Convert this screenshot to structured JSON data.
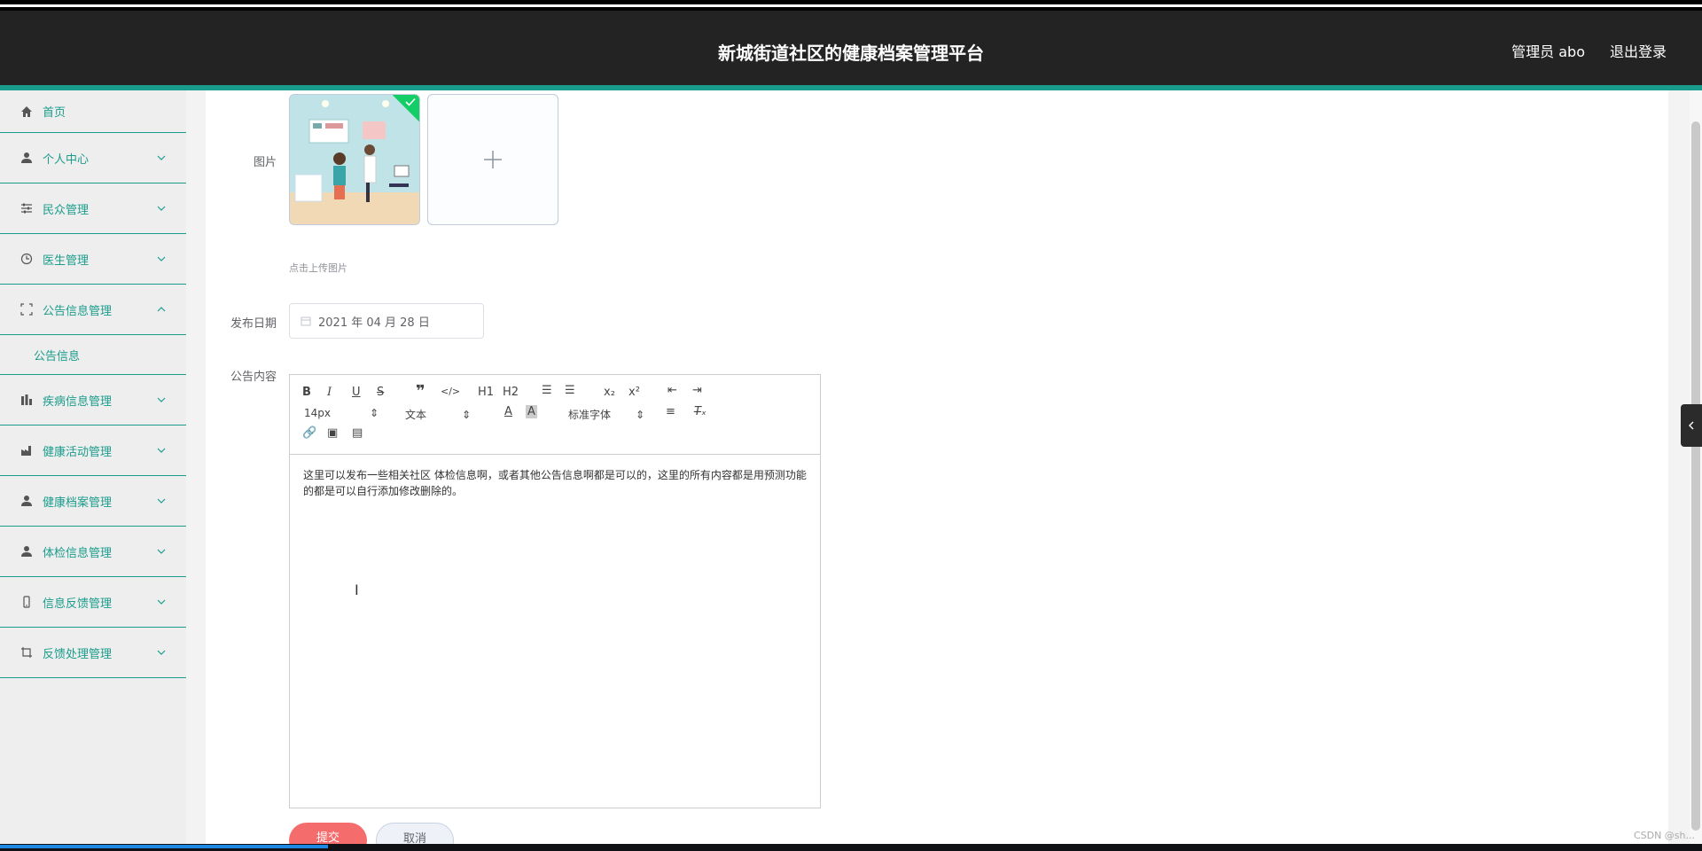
{
  "header": {
    "title": "新城街道社区的健康档案管理平台",
    "user": "管理员 abo",
    "logout": "退出登录"
  },
  "sidebar": {
    "items": [
      {
        "label": "首页",
        "icon": "home-icon"
      },
      {
        "label": "个人中心",
        "icon": "user-icon"
      },
      {
        "label": "民众管理",
        "icon": "sliders-icon"
      },
      {
        "label": "医生管理",
        "icon": "clock-icon"
      },
      {
        "label": "公告信息管理",
        "icon": "frame-icon",
        "expanded": true,
        "children": [
          {
            "label": "公告信息"
          }
        ]
      },
      {
        "label": "疾病信息管理",
        "icon": "chart-icon"
      },
      {
        "label": "健康活动管理",
        "icon": "factory-icon"
      },
      {
        "label": "健康档案管理",
        "icon": "user-icon"
      },
      {
        "label": "体检信息管理",
        "icon": "user-icon"
      },
      {
        "label": "信息反馈管理",
        "icon": "phone-icon"
      },
      {
        "label": "反馈处理管理",
        "icon": "crop-icon"
      }
    ]
  },
  "form": {
    "image_label": "图片",
    "upload_hint": "点击上传图片",
    "date_label": "发布日期",
    "date_value": "2021 年 04 月 28 日",
    "content_label": "公告内容",
    "content_text": "这里可以发布一些相关社区 体检信息啊，或者其他公告信息啊都是可以的，这里的所有内容都是用预测功能的都是可以自行添加修改删除的。",
    "submit": "提交",
    "cancel": "取消"
  },
  "editor": {
    "font_size": "14px",
    "header_select": "文本",
    "font_family": "标准字体",
    "h1": "H1",
    "h2": "H2"
  },
  "watermark": "CSDN @sh..."
}
